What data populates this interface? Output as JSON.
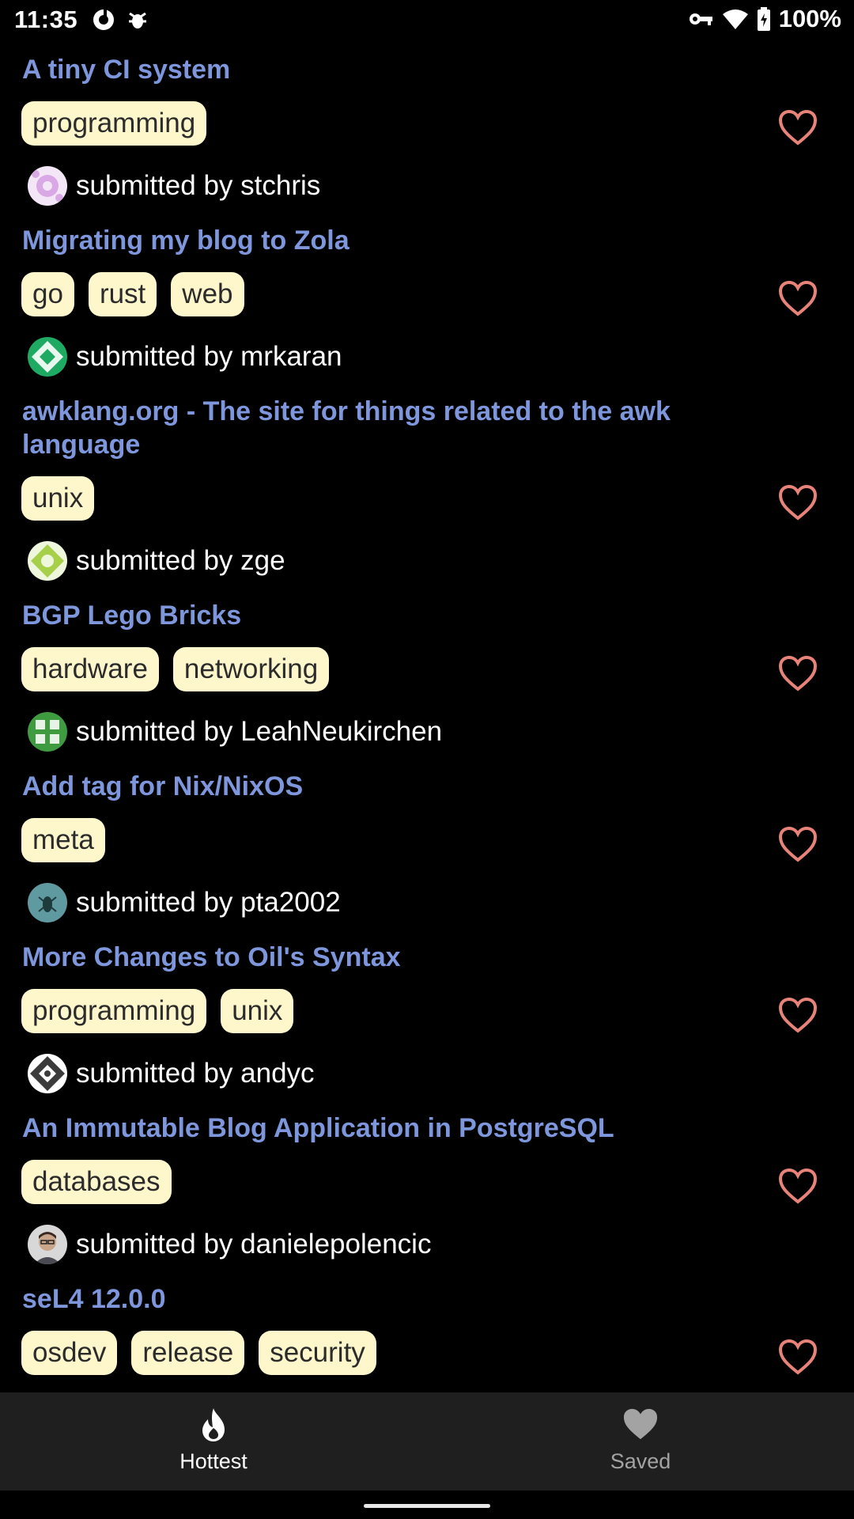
{
  "status_bar": {
    "time": "11:35",
    "battery": "100%"
  },
  "stories": [
    {
      "title": "A tiny CI system",
      "tags": [
        "programming"
      ],
      "submitted": "submitted by stchris",
      "avatar_color": "#e5c7ef"
    },
    {
      "title": "Migrating my blog to Zola",
      "tags": [
        "go",
        "rust",
        "web"
      ],
      "submitted": "submitted by mrkaran",
      "avatar_color": "#1faa63"
    },
    {
      "title": "awklang.org - The site for things related to the awk language",
      "tags": [
        "unix"
      ],
      "submitted": "submitted by zge",
      "avatar_color": "#a6d04a"
    },
    {
      "title": "BGP Lego Bricks",
      "tags": [
        "hardware",
        "networking"
      ],
      "submitted": "submitted by LeahNeukirchen",
      "avatar_color": "#3f9b3f"
    },
    {
      "title": "Add tag for Nix/NixOS",
      "tags": [
        "meta"
      ],
      "submitted": "submitted by pta2002",
      "avatar_color": "#5f9aa0"
    },
    {
      "title": "More Changes to Oil's Syntax",
      "tags": [
        "programming",
        "unix"
      ],
      "submitted": "submitted by andyc",
      "avatar_color": "#c9c9c9"
    },
    {
      "title": "An Immutable Blog Application in PostgreSQL",
      "tags": [
        "databases"
      ],
      "submitted": "submitted by danielepolencic",
      "avatar_color": "#8a7a6e"
    },
    {
      "title": "seL4 12.0.0",
      "tags": [
        "osdev",
        "release",
        "security"
      ],
      "submitted": "",
      "avatar_color": "#000000"
    }
  ],
  "bottom_nav": {
    "hottest_label": "Hottest",
    "saved_label": "Saved",
    "active": "Hottest"
  },
  "colors": {
    "title": "#7e97dc",
    "tag_bg": "#fff7cc",
    "heart": "#e8837a",
    "nav_bg": "#1f1f1f"
  }
}
